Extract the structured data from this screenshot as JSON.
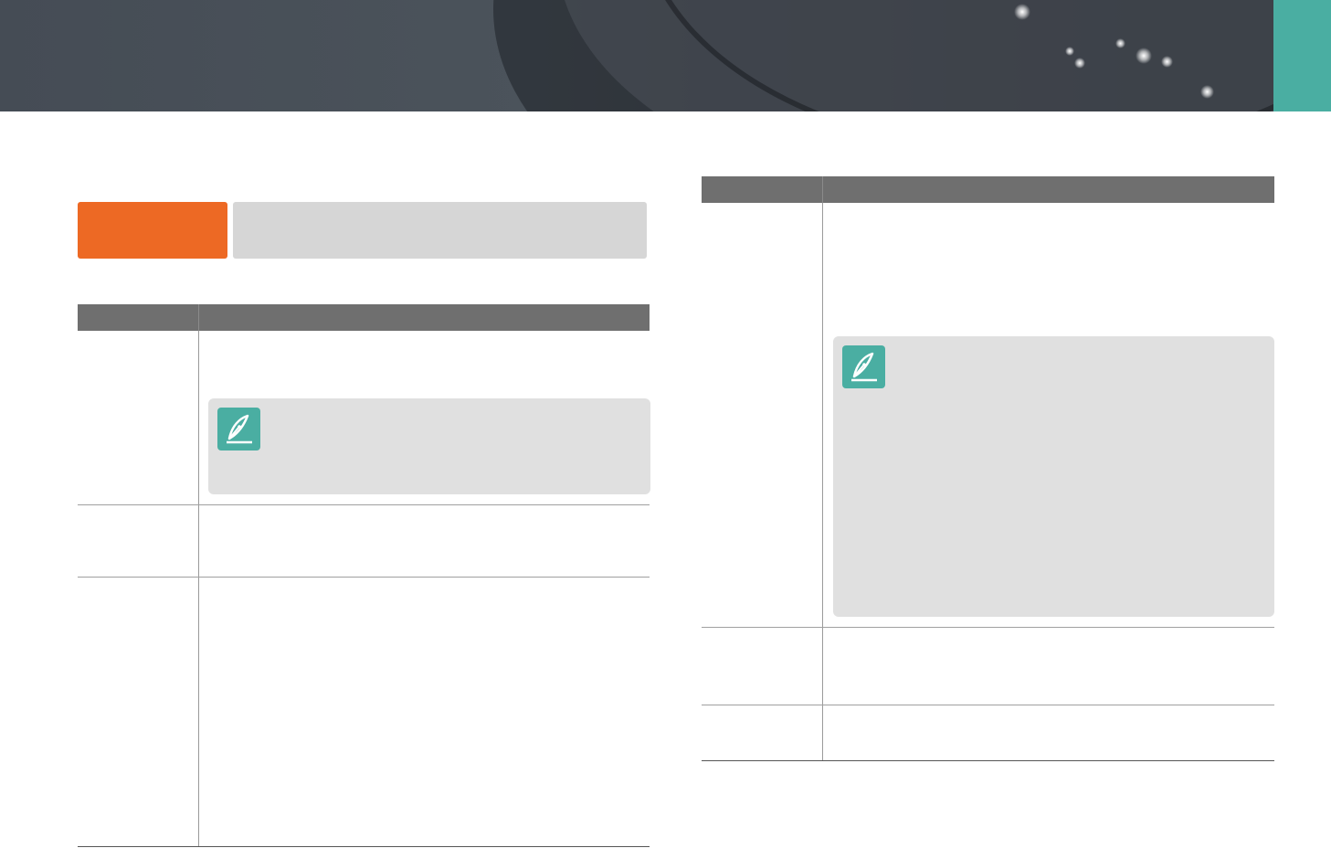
{
  "colors": {
    "banner": "#454c55",
    "accent_teal": "#4aaea2",
    "section_badge": "#ed6924",
    "section_title_bg": "#d6d6d6",
    "table_header": "#6f6f6f",
    "note_bg": "#e0e0e0"
  },
  "icons": {
    "note": "pen-nib-icon"
  }
}
